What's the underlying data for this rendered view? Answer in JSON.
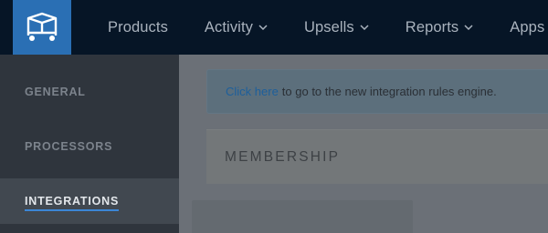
{
  "header": {
    "nav": [
      {
        "label": "Products",
        "has_dropdown": false
      },
      {
        "label": "Activity",
        "has_dropdown": true
      },
      {
        "label": "Upsells",
        "has_dropdown": true
      },
      {
        "label": "Reports",
        "has_dropdown": true
      },
      {
        "label": "Apps",
        "has_dropdown": false
      }
    ],
    "logo_icon": "box-cart-icon"
  },
  "sidebar": {
    "items": [
      {
        "label": "GENERAL",
        "active": false
      },
      {
        "label": "PROCESSORS",
        "active": false
      },
      {
        "label": "INTEGRATIONS",
        "active": true
      }
    ]
  },
  "main": {
    "notice": {
      "link_text": "Click here",
      "text": "to go to the new integration rules engine."
    },
    "section_title": "MEMBERSHIP"
  },
  "colors": {
    "topbar": "#061526",
    "logo_bg": "#2a6fb4",
    "sidebar": "#2f353d",
    "active_underline": "#3b86d6",
    "link": "#1d5f9b"
  }
}
